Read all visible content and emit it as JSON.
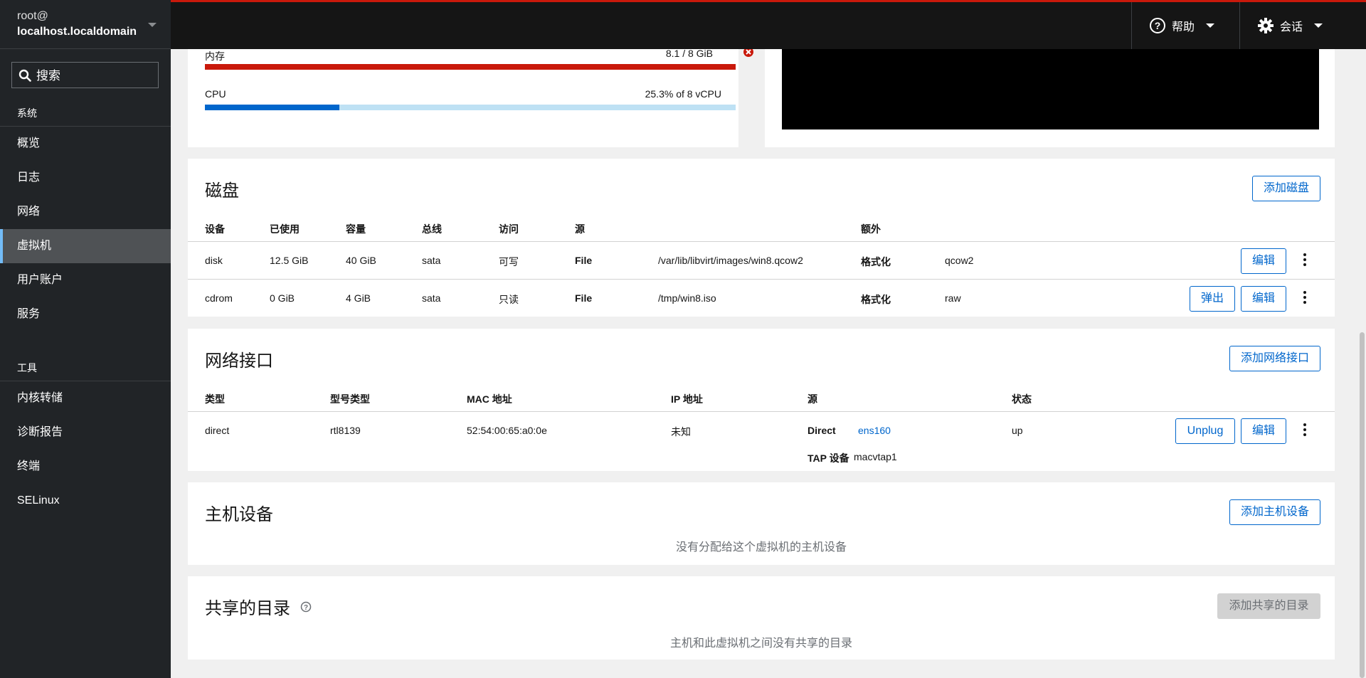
{
  "host": {
    "user": "root@",
    "name": "localhost.localdomain"
  },
  "search": {
    "placeholder": "搜索"
  },
  "nav": {
    "system_title": "系统",
    "system_items": [
      "概览",
      "日志",
      "网络",
      "虚拟机",
      "用户账户",
      "服务"
    ],
    "tools_title": "工具",
    "tools_items": [
      "内核转储",
      "诊断报告",
      "终端",
      "SELinux"
    ],
    "active": "虚拟机"
  },
  "topbar": {
    "help_label": "帮助",
    "session_label": "会话"
  },
  "usage": {
    "memory": {
      "label": "内存",
      "value": "8.1 / 8 GiB",
      "fraction": 1.0,
      "color": "#c9190b",
      "track": "#f0f0f0"
    },
    "cpu": {
      "label": "CPU",
      "value": "25.3% of 8 vCPU",
      "fraction": 0.253,
      "color": "#0066cc",
      "track": "#bee1f4"
    }
  },
  "disks": {
    "title": "磁盘",
    "add_label": "添加磁盘",
    "headers": [
      "设备",
      "已使用",
      "容量",
      "总线",
      "访问",
      "源",
      "额外"
    ],
    "rows": [
      {
        "device": "disk",
        "used": "12.5 GiB",
        "capacity": "40 GiB",
        "bus": "sata",
        "access": "可写",
        "source_type": "File",
        "source_path": "/var/lib/libvirt/images/win8.qcow2",
        "extra_label": "格式化",
        "extra_value": "qcow2",
        "edit": "编辑"
      },
      {
        "device": "cdrom",
        "used": "0 GiB",
        "capacity": "4 GiB",
        "bus": "sata",
        "access": "只读",
        "source_type": "File",
        "source_path": "/tmp/win8.iso",
        "extra_label": "格式化",
        "extra_value": "raw",
        "eject": "弹出",
        "edit": "编辑"
      }
    ]
  },
  "network": {
    "title": "网络接口",
    "add_label": "添加网络接口",
    "headers": [
      "类型",
      "型号类型",
      "MAC 地址",
      "IP 地址",
      "源",
      "状态"
    ],
    "row": {
      "type": "direct",
      "model": "rtl8139",
      "mac": "52:54:00:65:a0:0e",
      "ip": "未知",
      "source_label": "Direct",
      "source_value": "ens160",
      "tap_label": "TAP 设备",
      "tap_value": "macvtap1",
      "state": "up",
      "unplug": "Unplug",
      "edit": "编辑"
    }
  },
  "host_devices": {
    "title": "主机设备",
    "add_label": "添加主机设备",
    "empty": "没有分配给这个虚拟机的主机设备"
  },
  "shared_dirs": {
    "title": "共享的目录",
    "add_label": "添加共享的目录",
    "empty": "主机和此虚拟机之间没有共享的目录"
  }
}
